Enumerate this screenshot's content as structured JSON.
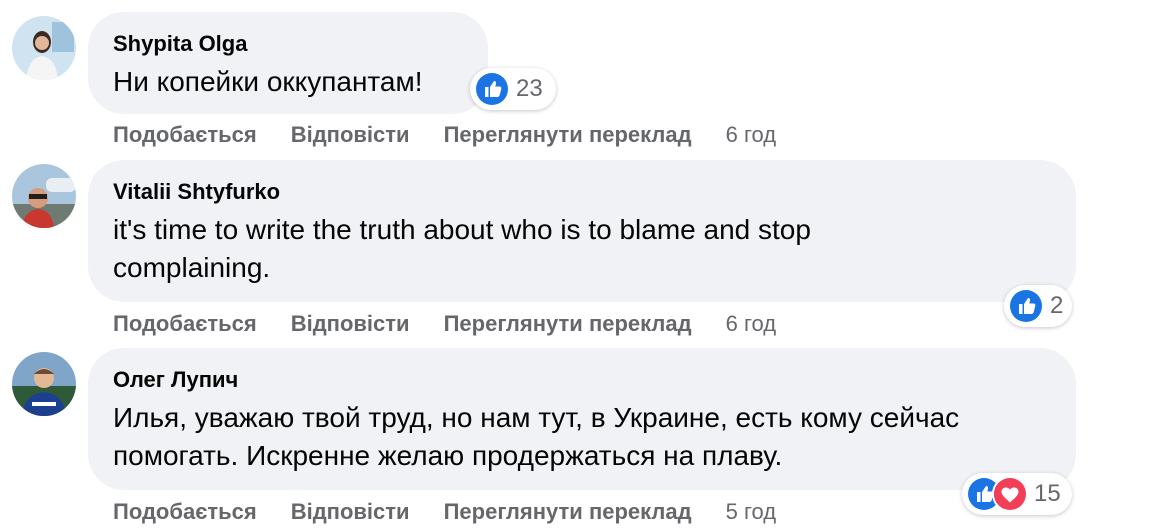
{
  "comments": [
    {
      "author": "Shypita Olga",
      "text": "Ни копейки оккупантам!",
      "reactions": {
        "icons": [
          "like-icon"
        ],
        "count": "23"
      },
      "actions": {
        "like": "Подобається",
        "reply": "Відповісти",
        "translate": "Переглянути переклад",
        "time": "6 год"
      }
    },
    {
      "author": "Vitalii Shtyfurko",
      "text": "it's time to write the truth about who is to blame and stop complaining.",
      "reactions": {
        "icons": [
          "like-icon"
        ],
        "count": "2"
      },
      "actions": {
        "like": "Подобається",
        "reply": "Відповісти",
        "translate": "Переглянути переклад",
        "time": "6 год"
      }
    },
    {
      "author": "Олег Лупич",
      "text": "Илья, уважаю твой труд, но нам тут, в Украине, есть кому сейчас помогать. Искренне желаю продержаться на плаву.",
      "reactions": {
        "icons": [
          "like-icon",
          "love-icon"
        ],
        "count": "15"
      },
      "actions": {
        "like": "Подобається",
        "reply": "Відповісти",
        "translate": "Переглянути переклад",
        "time": "5 год"
      }
    }
  ],
  "colors": {
    "bubble": "#f0f2f5",
    "secondary_text": "#65676b",
    "like_blue": "#1b74e4",
    "love_red": "#f33e58"
  }
}
